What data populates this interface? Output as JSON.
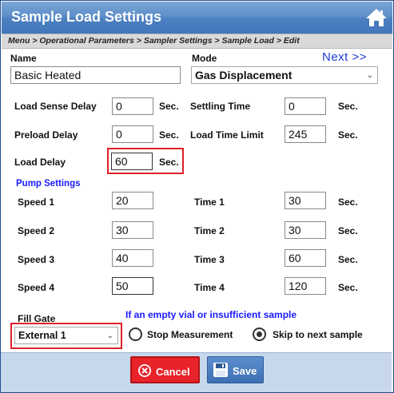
{
  "title": "Sample Load Settings",
  "breadcrumb": "Menu > Operational Parameters > Sampler Settings > Sample Load > Edit",
  "name": {
    "label": "Name",
    "value": "Basic Heated"
  },
  "mode": {
    "label": "Mode",
    "value": "Gas Displacement"
  },
  "next_label": "Next >>",
  "unit": "Sec.",
  "fields": {
    "load_sense_delay": {
      "label": "Load Sense Delay",
      "value": "0"
    },
    "settling_time": {
      "label": "Settling Time",
      "value": "0"
    },
    "preload_delay": {
      "label": "Preload Delay",
      "value": "0"
    },
    "load_time_limit": {
      "label": "Load Time Limit",
      "value": "245"
    },
    "load_delay": {
      "label": "Load Delay",
      "value": "60"
    }
  },
  "pump": {
    "heading": "Pump Settings",
    "rows": [
      {
        "speed_label": "Speed 1",
        "speed": "20",
        "time_label": "Time 1",
        "time": "30"
      },
      {
        "speed_label": "Speed 2",
        "speed": "30",
        "time_label": "Time 2",
        "time": "30"
      },
      {
        "speed_label": "Speed 3",
        "speed": "40",
        "time_label": "Time 3",
        "time": "60"
      },
      {
        "speed_label": "Speed 4",
        "speed": "50",
        "time_label": "Time 4",
        "time": "120"
      }
    ]
  },
  "fill_gate": {
    "label": "Fill Gate",
    "value": "External 1"
  },
  "empty_vial": {
    "heading": "If an empty vial or insufficient sample",
    "options": [
      "Stop Measurement",
      "Skip to next sample"
    ],
    "selected": "Skip to next sample"
  },
  "buttons": {
    "cancel": "Cancel",
    "save": "Save"
  },
  "colors": {
    "titlebar": "#4a7fc0",
    "highlight": "#e0202a",
    "cancel": "#e8232a",
    "link": "#1a3ad6"
  }
}
